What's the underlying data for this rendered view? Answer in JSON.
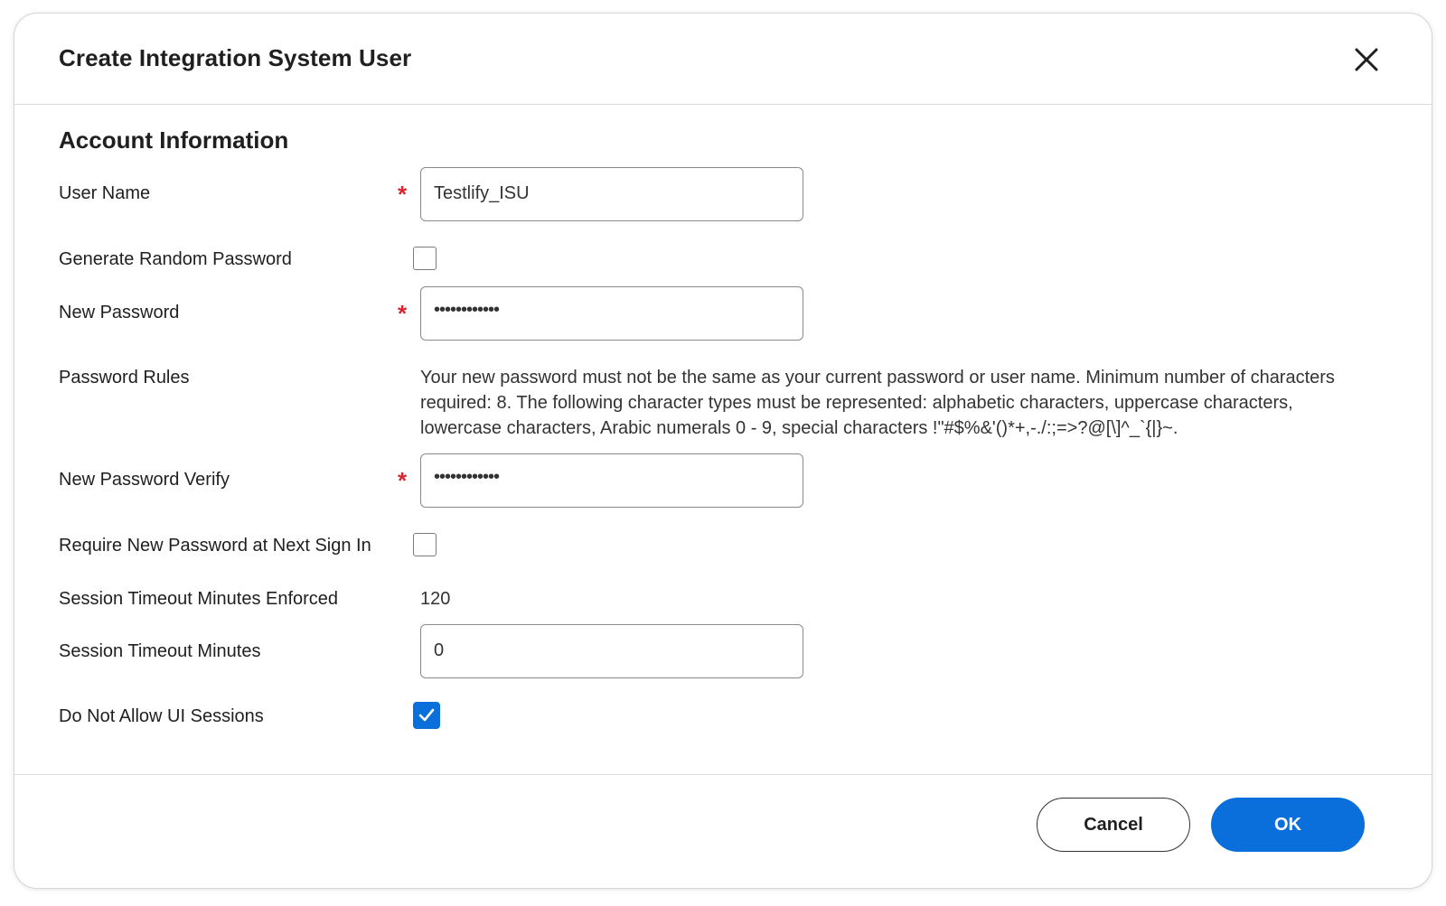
{
  "dialog": {
    "title": "Create Integration System User",
    "close_icon": "close-icon"
  },
  "section": {
    "title": "Account Information"
  },
  "fields": {
    "user_name": {
      "label": "User Name",
      "required": "*",
      "value": "Testlify_ISU"
    },
    "generate_random_password": {
      "label": "Generate Random Password",
      "checked": false
    },
    "new_password": {
      "label": "New Password",
      "required": "*",
      "value": "••••••••••••"
    },
    "password_rules": {
      "label": "Password Rules",
      "text": "Your new password must not be the same as your current password or user name. Minimum number of characters required: 8. The following character types must be represented: alphabetic characters, uppercase characters, lowercase characters, Arabic numerals 0 - 9, special characters !\"#$%&'()*+,-./:;=>?@[\\]^_`{|}~."
    },
    "new_password_verify": {
      "label": "New Password Verify",
      "required": "*",
      "value": "••••••••••••"
    },
    "require_new_password": {
      "label": "Require New Password at Next Sign In",
      "checked": false
    },
    "session_timeout_enforced": {
      "label": "Session Timeout Minutes Enforced",
      "value": "120"
    },
    "session_timeout_minutes": {
      "label": "Session Timeout Minutes",
      "value": "0"
    },
    "do_not_allow_ui_sessions": {
      "label": "Do Not Allow UI Sessions",
      "checked": true
    }
  },
  "footer": {
    "cancel_label": "Cancel",
    "ok_label": "OK"
  },
  "colors": {
    "primary": "#0a6edb",
    "required": "#d8262f",
    "text": "#1f1f1f"
  }
}
